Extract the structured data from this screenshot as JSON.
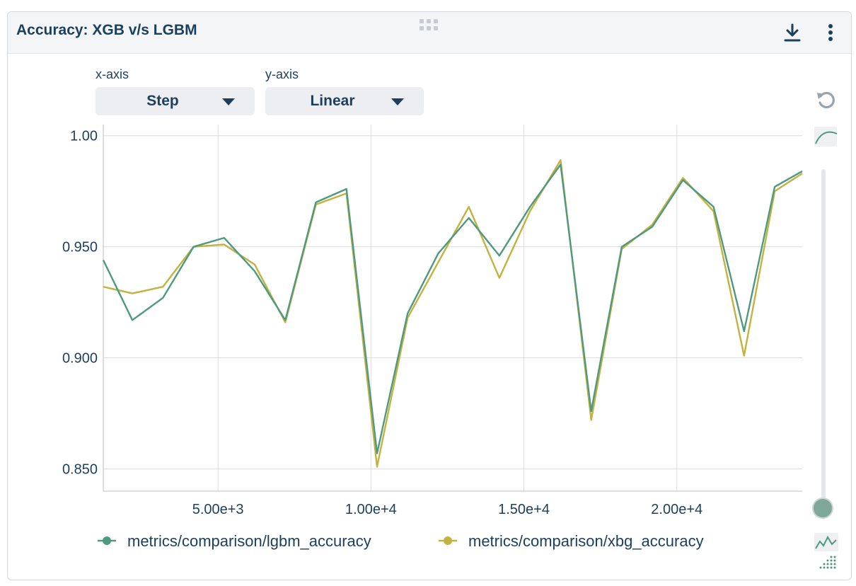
{
  "panel": {
    "title": "Accuracy: XGB v/s LGBM",
    "download_icon": "download-icon",
    "menu_icon": "vertical-dots-icon",
    "drag_icon": "drag-grid-icon"
  },
  "controls": {
    "x_axis_label": "x-axis",
    "x_axis_value": "Step",
    "y_axis_label": "y-axis",
    "y_axis_value": "Linear",
    "reset_icon": "reset-zoom-icon",
    "smooth_icon": "smoothing-curve-icon",
    "raw_icon": "raw-data-icon"
  },
  "colors": {
    "lgbm": "#4f9a7e",
    "xgb": "#c3b23f",
    "text": "#1c3f5e",
    "grid": "#dcdcdc"
  },
  "chart_data": {
    "type": "line",
    "title": "Accuracy: XGB v/s LGBM",
    "xlabel": "Step",
    "ylabel": "",
    "xlim": [
      1250,
      24100
    ],
    "ylim": [
      0.84,
      1.005
    ],
    "x_ticks": [
      5000,
      10000,
      15000,
      20000
    ],
    "x_tick_labels": [
      "5.00e+3",
      "1.00e+4",
      "1.50e+4",
      "2.00e+4"
    ],
    "y_ticks": [
      0.85,
      0.9,
      0.95,
      1.0
    ],
    "y_tick_labels": [
      "0.850",
      "0.900",
      "0.950",
      "1.00"
    ],
    "grid": true,
    "legend_position": "bottom",
    "x": [
      1250,
      2200,
      3200,
      4200,
      5200,
      6200,
      7200,
      8200,
      9200,
      10200,
      11200,
      12200,
      13200,
      14200,
      15200,
      16200,
      17200,
      18200,
      19200,
      20200,
      21200,
      22200,
      23200,
      24100
    ],
    "series": [
      {
        "name": "metrics/comparison/lgbm_accuracy",
        "color": "#4f9a7e",
        "values": [
          0.944,
          0.917,
          0.927,
          0.95,
          0.954,
          0.939,
          0.917,
          0.97,
          0.976,
          0.857,
          0.92,
          0.947,
          0.963,
          0.946,
          0.968,
          0.987,
          0.876,
          0.95,
          0.959,
          0.98,
          0.968,
          0.912,
          0.977,
          0.984
        ]
      },
      {
        "name": "metrics/comparison/xbg_accuracy",
        "color": "#c3b23f",
        "values": [
          0.932,
          0.929,
          0.932,
          0.95,
          0.951,
          0.942,
          0.916,
          0.969,
          0.974,
          0.851,
          0.918,
          0.943,
          0.968,
          0.936,
          0.966,
          0.989,
          0.872,
          0.949,
          0.96,
          0.981,
          0.966,
          0.901,
          0.975,
          0.983
        ]
      }
    ]
  }
}
